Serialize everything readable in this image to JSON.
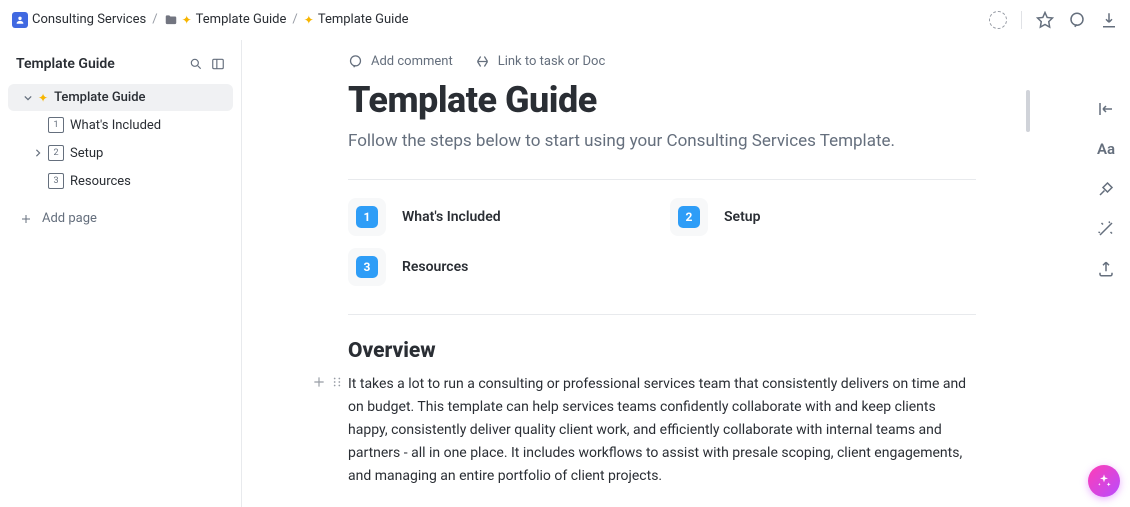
{
  "breadcrumb": {
    "space": "Consulting Services",
    "folder": "Template Guide",
    "doc": "Template Guide"
  },
  "sidebar": {
    "title": "Template Guide",
    "tree": {
      "root": "Template Guide",
      "children": [
        {
          "num": "1",
          "label": "What's Included"
        },
        {
          "num": "2",
          "label": "Setup"
        },
        {
          "num": "3",
          "label": "Resources"
        }
      ]
    },
    "add_page": "Add page"
  },
  "doc": {
    "actions": {
      "comment": "Add comment",
      "link": "Link to task or Doc"
    },
    "title": "Template Guide",
    "subtitle": "Follow the steps below to start using your Consulting Services Template.",
    "nav": [
      {
        "num": "1",
        "label": "What's Included"
      },
      {
        "num": "2",
        "label": "Setup"
      },
      {
        "num": "3",
        "label": "Resources"
      }
    ],
    "sections": {
      "overview": {
        "heading": "Overview",
        "p1": "It takes a lot to run a consulting or professional services team that consistently delivers on time and on budget. This template can help services teams confidently collaborate with and keep clients happy, consistently deliver quality client work, and efficiently collaborate with internal teams and partners - all in one place. It includes workflows to assist with presale scoping, client engagements, and managing an entire portfolio of client projects."
      }
    }
  }
}
